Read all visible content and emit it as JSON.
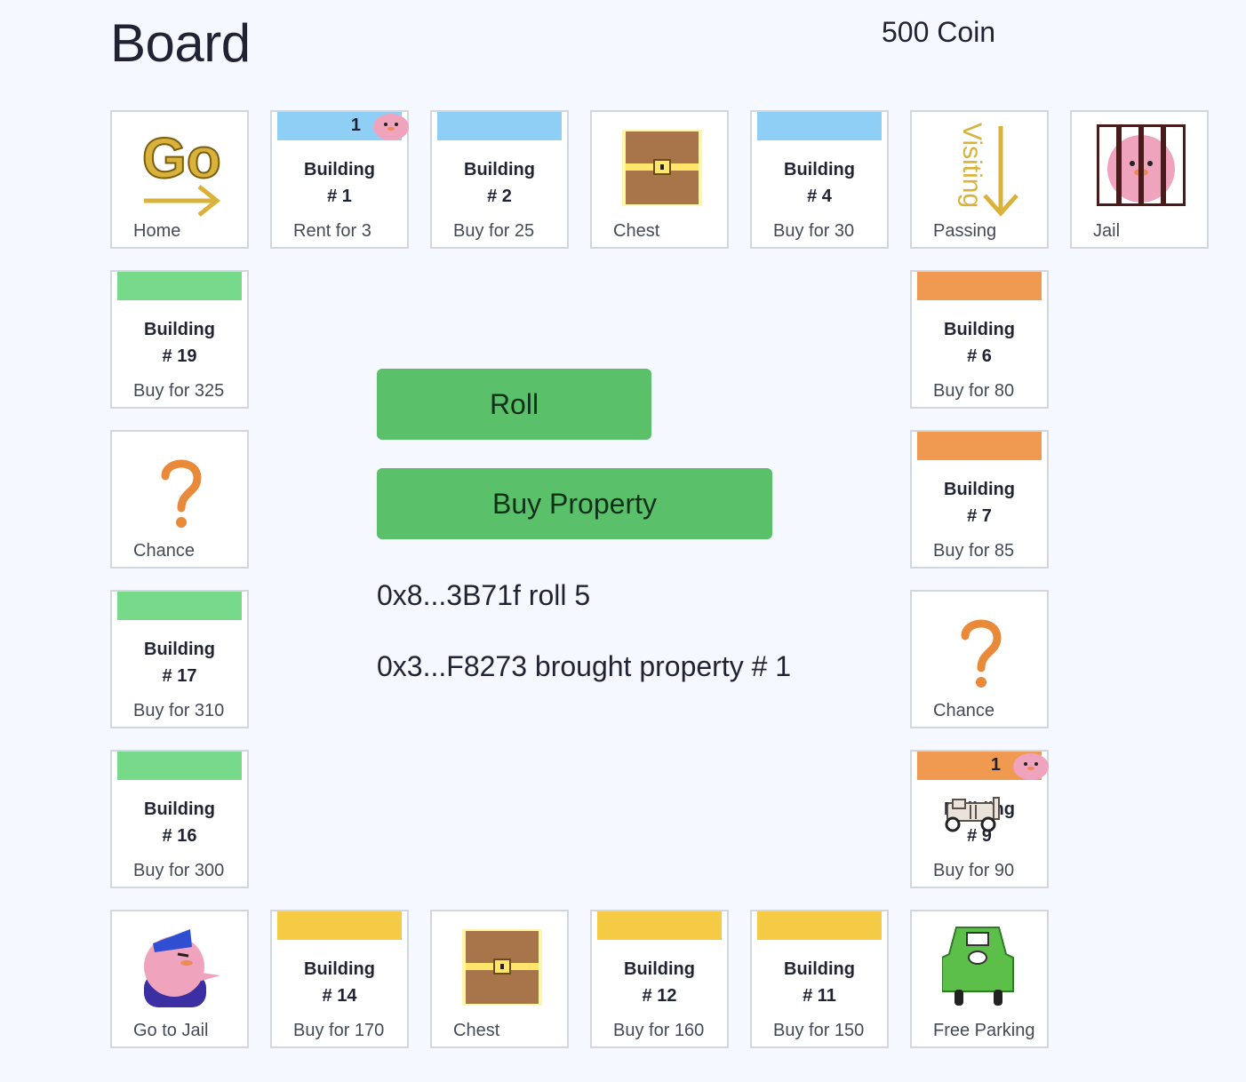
{
  "header": {
    "title": "Board",
    "coins": "500 Coin"
  },
  "colors": {
    "blue": "#8fcff5",
    "green": "#77d98a",
    "orange": "#ef9a50",
    "yellow": "#f5cb45",
    "button": "#5bc06a",
    "background": "#f5f8fe"
  },
  "cells": {
    "home": {
      "caption": "Home",
      "icon": "go-arrow-icon"
    },
    "b1": {
      "name_line1": "Building",
      "name_line2": "# 1",
      "caption": "Rent for 3",
      "owner_count": "1",
      "band": "blue"
    },
    "b2": {
      "name_line1": "Building",
      "name_line2": "# 2",
      "caption": "Buy for 25",
      "band": "blue"
    },
    "chest_top": {
      "caption": "Chest",
      "icon": "treasure-chest-icon"
    },
    "b4": {
      "name_line1": "Building",
      "name_line2": "# 4",
      "caption": "Buy for 30",
      "band": "blue"
    },
    "visiting": {
      "caption": "Passing",
      "icon_text": "Visiting"
    },
    "jail": {
      "caption": "Jail",
      "icon": "jail-bars-icon"
    },
    "b19": {
      "name_line1": "Building",
      "name_line2": "# 19",
      "caption": "Buy for 325",
      "band": "green"
    },
    "b6": {
      "name_line1": "Building",
      "name_line2": "# 6",
      "caption": "Buy for 80",
      "band": "orange"
    },
    "chance_left": {
      "caption": "Chance",
      "icon": "question-mark-icon"
    },
    "b7": {
      "name_line1": "Building",
      "name_line2": "# 7",
      "caption": "Buy for 85",
      "band": "orange"
    },
    "b17": {
      "name_line1": "Building",
      "name_line2": "# 17",
      "caption": "Buy for 310",
      "band": "green"
    },
    "chance_right": {
      "caption": "Chance",
      "icon": "question-mark-icon"
    },
    "b16": {
      "name_line1": "Building",
      "name_line2": "# 16",
      "caption": "Buy for 300",
      "band": "green"
    },
    "b9": {
      "name_line1": "Building",
      "name_line2": "# 9",
      "caption": "Buy for 90",
      "owner_count": "1",
      "band": "orange"
    },
    "gotojail": {
      "caption": "Go to Jail",
      "icon": "police-duck-icon"
    },
    "b14": {
      "name_line1": "Building",
      "name_line2": "# 14",
      "caption": "Buy for 170",
      "band": "yellow"
    },
    "chest_bottom": {
      "caption": "Chest",
      "icon": "treasure-chest-icon"
    },
    "b12": {
      "name_line1": "Building",
      "name_line2": "# 12",
      "caption": "Buy for 160",
      "band": "yellow"
    },
    "b11": {
      "name_line1": "Building",
      "name_line2": "# 11",
      "caption": "Buy for 150",
      "band": "yellow"
    },
    "parking": {
      "caption": "Free Parking",
      "icon": "green-car-icon"
    }
  },
  "actions": {
    "roll": "Roll",
    "buy": "Buy Property"
  },
  "log": [
    "0x8...3B71f roll 5",
    "0x3...F8273 brought property # 1"
  ]
}
